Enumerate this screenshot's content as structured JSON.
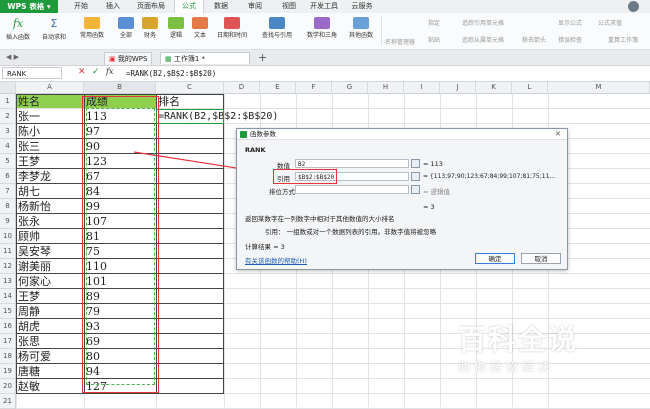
{
  "app": {
    "name": "WPS 表格"
  },
  "menu_tabs": [
    "开始",
    "插入",
    "页面布局",
    "公式",
    "数据",
    "审阅",
    "视图",
    "开发工具",
    "云服务"
  ],
  "active_tab": "公式",
  "ribbon_buttons": [
    "插入函数",
    "自动求和",
    "常用函数",
    "全部",
    "财务",
    "逻辑",
    "文本",
    "日期和时间",
    "查找与引用",
    "数学和三角",
    "其他函数"
  ],
  "ribbon_right": [
    "名称管理器",
    "指定",
    "粘贴",
    "追踪引用单元格",
    "追踪从属单元格",
    "移去箭头",
    "显示公式",
    "错误检查",
    "公式求值",
    "重算工作簿"
  ],
  "doc_tabs": {
    "home": "我的WPS",
    "active": "工作簿1 *",
    "add": "+"
  },
  "formula_bar": {
    "namebox": "RANK",
    "content": "=RANK(B2,$B$2:$B$20)"
  },
  "columns": [
    "A",
    "B",
    "C",
    "D",
    "E",
    "F",
    "G",
    "H",
    "I",
    "J",
    "K",
    "L",
    "M"
  ],
  "column_header_highlight": "E",
  "rows": [
    {
      "n": "1",
      "name": "姓名",
      "score": "成绩",
      "rank": "排名"
    },
    {
      "n": "2",
      "name": "张一",
      "score": "113",
      "rank": "=RANK(B2,$B$2:$B$20)"
    },
    {
      "n": "3",
      "name": "陈小",
      "score": "97",
      "rank": ""
    },
    {
      "n": "4",
      "name": "张三",
      "score": "90",
      "rank": ""
    },
    {
      "n": "5",
      "name": "王梦",
      "score": "123",
      "rank": ""
    },
    {
      "n": "6",
      "name": "李梦龙",
      "score": "67",
      "rank": ""
    },
    {
      "n": "7",
      "name": "胡七",
      "score": "84",
      "rank": ""
    },
    {
      "n": "8",
      "name": "杨新怡",
      "score": "99",
      "rank": ""
    },
    {
      "n": "9",
      "name": "张永",
      "score": "107",
      "rank": ""
    },
    {
      "n": "10",
      "name": "顾帅",
      "score": "81",
      "rank": ""
    },
    {
      "n": "11",
      "name": "吴安琴",
      "score": "75",
      "rank": ""
    },
    {
      "n": "12",
      "name": "谢美丽",
      "score": "110",
      "rank": ""
    },
    {
      "n": "13",
      "name": "何家心",
      "score": "101",
      "rank": ""
    },
    {
      "n": "14",
      "name": "王梦",
      "score": "89",
      "rank": ""
    },
    {
      "n": "15",
      "name": "周静",
      "score": "79",
      "rank": ""
    },
    {
      "n": "16",
      "name": "胡虎",
      "score": "93",
      "rank": ""
    },
    {
      "n": "17",
      "name": "张思",
      "score": "69",
      "rank": ""
    },
    {
      "n": "18",
      "name": "杨可爱",
      "score": "80",
      "rank": ""
    },
    {
      "n": "19",
      "name": "唐糖",
      "score": "94",
      "rank": ""
    },
    {
      "n": "20",
      "name": "赵敏",
      "score": "127",
      "rank": ""
    },
    {
      "n": "21",
      "name": "",
      "score": "",
      "rank": ""
    }
  ],
  "dialog": {
    "title": "函数参数",
    "func": "RANK",
    "arg1_label": "数值",
    "arg1_value": "B2",
    "arg1_result": "= 113",
    "arg2_label": "引用",
    "arg2_value": "$B$2:$B$20",
    "arg2_result": "= {113;97;90;123;67;84;99;107;81;75;11...",
    "arg3_label": "排位方式",
    "arg3_value": "",
    "arg3_result": "= 逻辑值",
    "mid_result": "= 3",
    "desc": "返回某数字在一列数字中相对于其他数值的大小排名",
    "param_desc": "引用：  一组数或对一个数据列表的引用。非数字值将被忽略",
    "calc_result": "计算结果 = 3",
    "help_link": "有关该函数的帮助(H)",
    "ok": "确定",
    "cancel": "取消"
  },
  "watermark": {
    "title": "百科全说",
    "subtitle": "助你轻松解决"
  },
  "colors": {
    "brand": "#1e9a3c",
    "header_fill": "#8fd14f",
    "highlight": "#e8333a"
  }
}
